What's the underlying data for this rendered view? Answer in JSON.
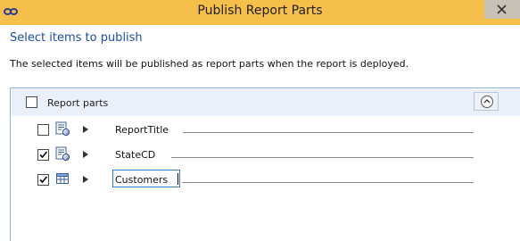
{
  "window": {
    "title": "Publish Report Parts",
    "titlebar_color": "#f6bf4c"
  },
  "heading": "Select items to publish",
  "description": "The selected items will be published as report parts when the report is deployed.",
  "group": {
    "label": "Report parts",
    "checked": false,
    "collapse_icon": "chevron-up-icon"
  },
  "items": [
    {
      "name": "ReportTitle",
      "checked": false,
      "icon": "textbox-icon",
      "editing": false
    },
    {
      "name": "StateCD",
      "checked": true,
      "icon": "textbox-icon",
      "editing": false
    },
    {
      "name": "Customers",
      "checked": true,
      "icon": "table-icon",
      "editing": true
    }
  ]
}
